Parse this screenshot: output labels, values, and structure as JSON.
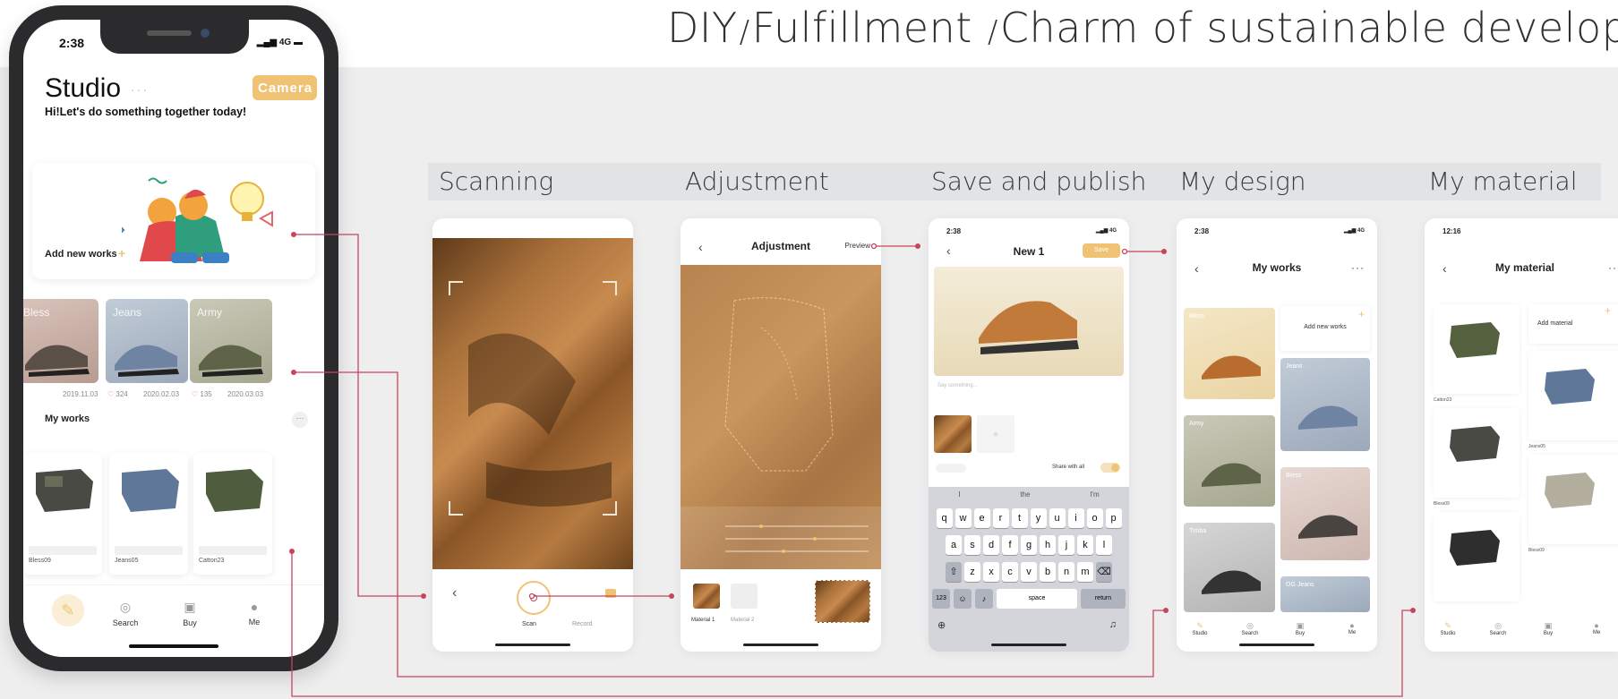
{
  "headline": {
    "part1": "DIY",
    "sep1": "/",
    "part2": "Fulfillment",
    "sep2": "/",
    "part3": "Charm of sustainable developm"
  },
  "steps": [
    "Scanning",
    "Adjustment",
    "Save and publish",
    "My design",
    "My material"
  ],
  "colors": {
    "accent": "#efc373",
    "connector": "#c8445c",
    "banner": "#eeeeef"
  },
  "main_phone": {
    "time": "2:38",
    "signal": "4G",
    "title": "Studio",
    "title_dots": "···",
    "camera_label": "Camera",
    "subtitle": "Hi!Let's do something together today!",
    "add_new_works": "Add new works",
    "tiles": [
      {
        "label": "Bless",
        "date": "2019.11.03"
      },
      {
        "label": "Jeans",
        "likes": "324",
        "date": "2020.02.03"
      },
      {
        "label": "Army",
        "likes": "135",
        "date": "2020.03.03"
      }
    ],
    "my_works": "My works",
    "works": [
      {
        "name": "Bless09"
      },
      {
        "name": "Jeans05"
      },
      {
        "name": "Catton23"
      }
    ],
    "tabs": [
      "Search",
      "Buy",
      "Me"
    ]
  },
  "scanning": {
    "scan": "Scan",
    "record": "Record"
  },
  "adjustment": {
    "title": "Adjustment",
    "preview": "Preview",
    "material1": "Material 1",
    "material2": "Material 2"
  },
  "publish": {
    "time": "2:38",
    "signal": "4G",
    "title": "New 1",
    "save": "Save",
    "placeholder": "Say something...",
    "share_all": "Share with all",
    "suggestions": [
      "I",
      "the",
      "I'm"
    ],
    "row1": [
      "q",
      "w",
      "e",
      "r",
      "t",
      "y",
      "u",
      "i",
      "o",
      "p"
    ],
    "row2": [
      "a",
      "s",
      "d",
      "f",
      "g",
      "h",
      "j",
      "k",
      "l"
    ],
    "row3": [
      "z",
      "x",
      "c",
      "v",
      "b",
      "n",
      "m"
    ],
    "num_key": "123",
    "space": "space",
    "return": "return"
  },
  "my_design": {
    "time": "2:38",
    "signal": "4G",
    "title": "My works",
    "add_new": "Add new works",
    "tile_labels": [
      "Bless",
      "Jeans",
      "Army",
      "Bless",
      "Timba",
      "OG Jeans"
    ],
    "tabs": [
      "Studio",
      "Search",
      "Buy",
      "Me"
    ]
  },
  "my_material": {
    "time": "12:16",
    "title": "My material",
    "add": "Add material",
    "names": [
      "Catton23",
      "Jeans05",
      "Bless09",
      "Bless09"
    ],
    "tabs": [
      "Studio",
      "Search",
      "Buy",
      "Me"
    ]
  }
}
